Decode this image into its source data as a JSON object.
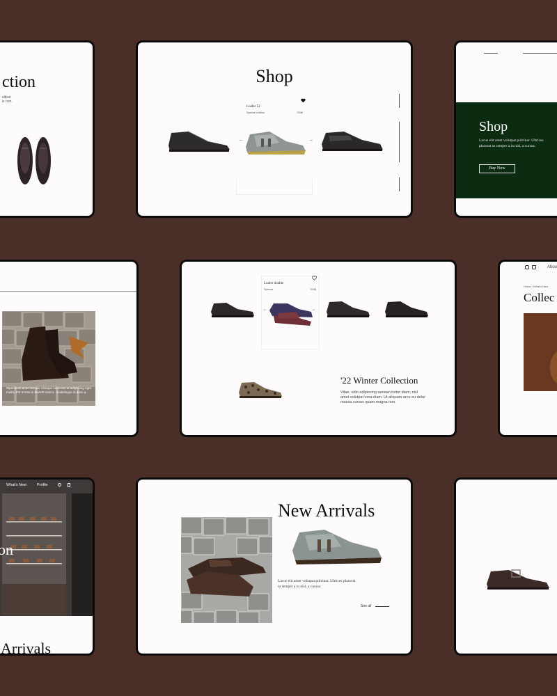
{
  "palette": {
    "background": "#4a2f29",
    "card": "#fdfbfc",
    "border": "#0b0b0b",
    "green_panel": "#0c2c12"
  },
  "card1": {
    "title": "ction",
    "body_lines": [
      "ultpat",
      "is non."
    ]
  },
  "card2": {
    "title": "Shop",
    "product_name": "Loafer 52",
    "product_sub": "Special edition",
    "product_price": "700$",
    "heart_icon": "heart-icon",
    "arrow_left": "←",
    "arrow_right": "→"
  },
  "card3": {
    "title": "Shop",
    "body": "Lacus elit amet volutpat pulvinar. Ultrices placerat ut semper a in nisl, a cursus.",
    "button": "Buy Now"
  },
  "card4": {
    "caption": "Stpendium amet semper tristique nulla non ut adipiscing eget mollis. Est ornare in blandit viverra. Scelerisque id diam a."
  },
  "card5": {
    "product_name": "Loafer double",
    "product_sub": "Special",
    "product_price": "700$",
    "title": "'22 Winter Collection",
    "body": "Vitae, odio adipiscing aenean tortor diam, nisl amet volutpat urna diam. Ut aliquam arcu eu dolor massa cursus quam magna non."
  },
  "card6": {
    "nav_about": "About",
    "breadcrumb": "Home / What's New",
    "title": "Collec"
  },
  "card7": {
    "nav": [
      "What's New",
      "Profile"
    ],
    "title": "on",
    "bottom_title": "Arrivals"
  },
  "card8": {
    "title": "New Arrivals",
    "body": "Lacus elit amet volutpat pulvinar. Ultrices placerat ut semper a in nisl, a cursus.",
    "link": "See all"
  }
}
